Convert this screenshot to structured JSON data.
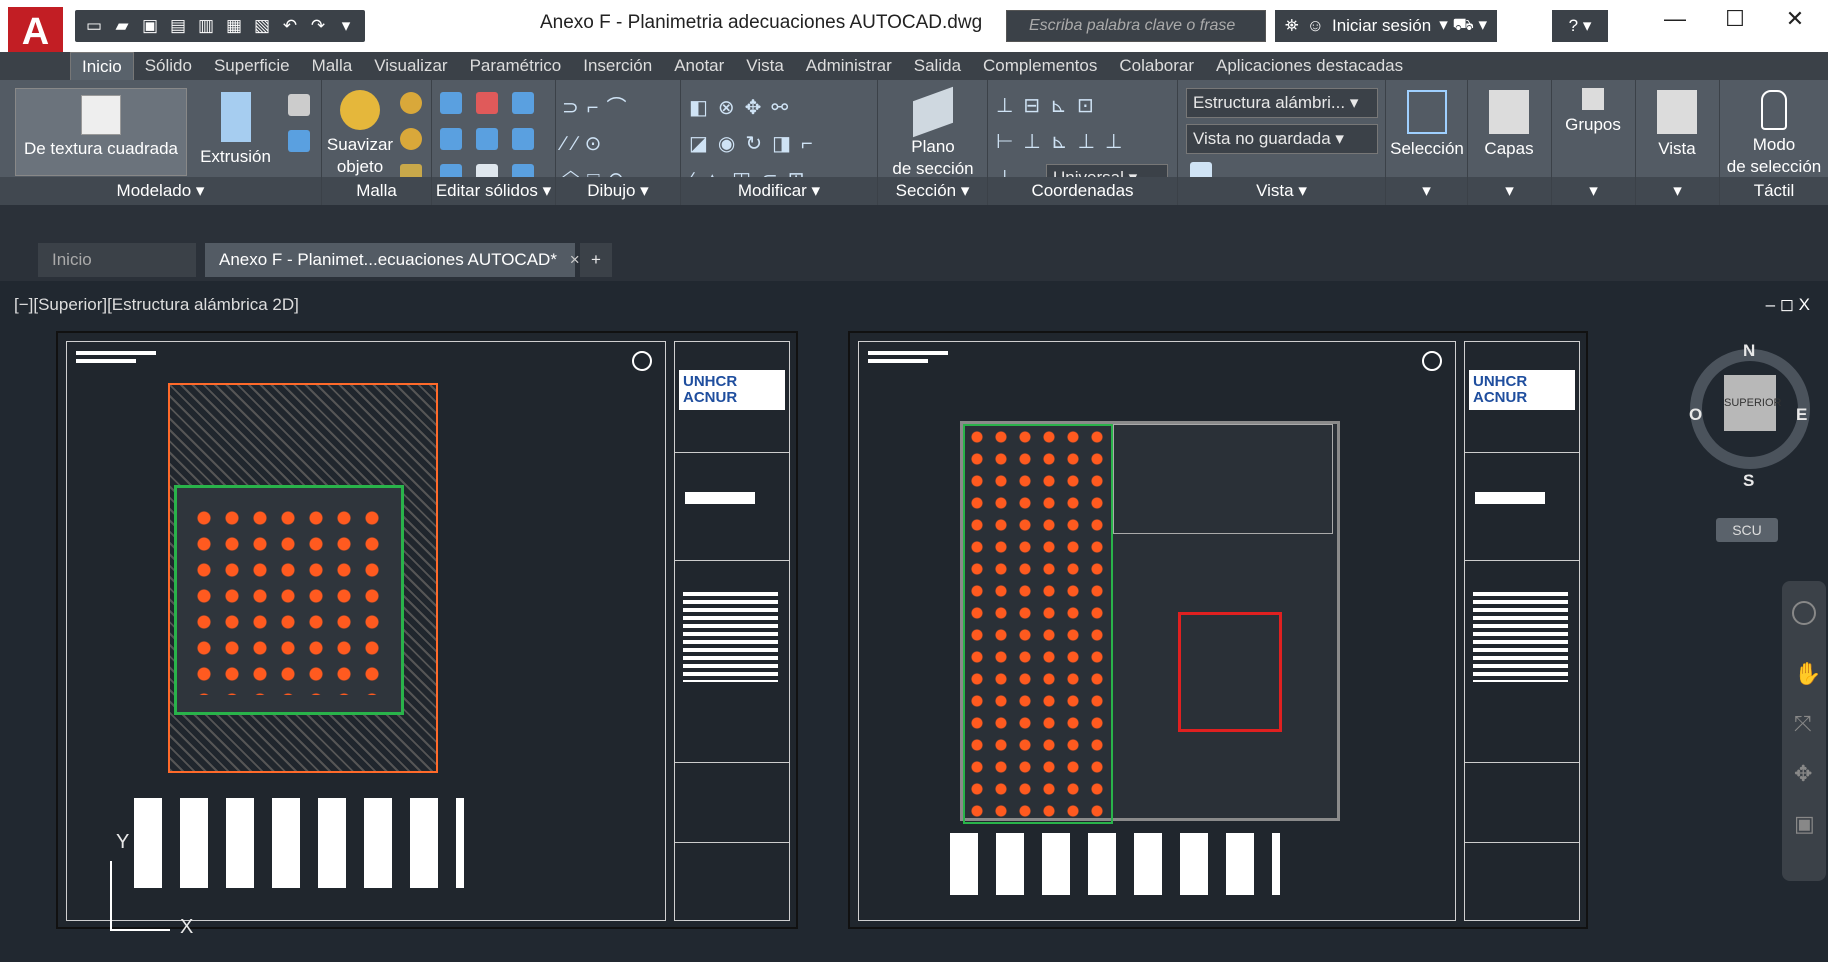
{
  "app": {
    "logo_letter": "A",
    "title": "Anexo F - Planimetria adecuaciones AUTOCAD.dwg"
  },
  "search": {
    "placeholder": "Escriba palabra clave o frase"
  },
  "account": {
    "signin_label": "Iniciar sesión"
  },
  "window_controls": {
    "minimize": "—",
    "maximize": "☐",
    "close": "✕"
  },
  "ribbon_tabs": [
    "Inicio",
    "Sólido",
    "Superficie",
    "Malla",
    "Visualizar",
    "Paramétrico",
    "Inserción",
    "Anotar",
    "Vista",
    "Administrar",
    "Salida",
    "Complementos",
    "Colaborar",
    "Aplicaciones destacadas"
  ],
  "panels": {
    "modelado": {
      "label": "Modelado ▾",
      "btn1": "De textura cuadrada",
      "btn2": "Extrusión"
    },
    "malla": {
      "label": "Malla",
      "btn1a": "Suavizar",
      "btn1b": "objeto"
    },
    "editar_solidos": {
      "label": "Editar sólidos ▾"
    },
    "dibujo": {
      "label": "Dibujo ▾"
    },
    "modificar": {
      "label": "Modificar ▾"
    },
    "seccion": {
      "label": "Sección ▾",
      "btn1a": "Plano",
      "btn1b": "de sección"
    },
    "coordenadas": {
      "label": "Coordenadas",
      "ucs": "Universal"
    },
    "vista": {
      "label": "Vista ▾",
      "visual_style": "Estructura alámbri...",
      "named_view": "Vista no guardada"
    },
    "seleccion": {
      "label": "Selección"
    },
    "capas": {
      "label": "Capas"
    },
    "grupos": {
      "label": "Grupos"
    },
    "vista2": {
      "label": "Vista"
    },
    "tactil": {
      "label": "Táctil",
      "btn1a": "Modo",
      "btn1b": "de selección"
    }
  },
  "doc_tabs": {
    "home": "Inicio",
    "active": "Anexo F - Planimet...ecuaciones AUTOCAD*",
    "add": "+"
  },
  "viewport": {
    "label": "[−][Superior][Estructura alámbrica 2D]",
    "controls": "–  ◻  X",
    "compass": {
      "n": "N",
      "s": "S",
      "e": "E",
      "w": "O",
      "cube": "SUPERIOR"
    },
    "ucs_button": "SCU",
    "axis_y": "Y",
    "axis_x": "X"
  },
  "sheets": [
    {
      "logo_line1": "UNHCR",
      "logo_line2": "ACNUR"
    },
    {
      "logo_line1": "UNHCR",
      "logo_line2": "ACNUR"
    }
  ],
  "colors": {
    "accent": "#c21e24",
    "cad_bg": "#212830",
    "orange": "#ff5a1f",
    "green": "#29b34a",
    "red": "#e02020"
  }
}
